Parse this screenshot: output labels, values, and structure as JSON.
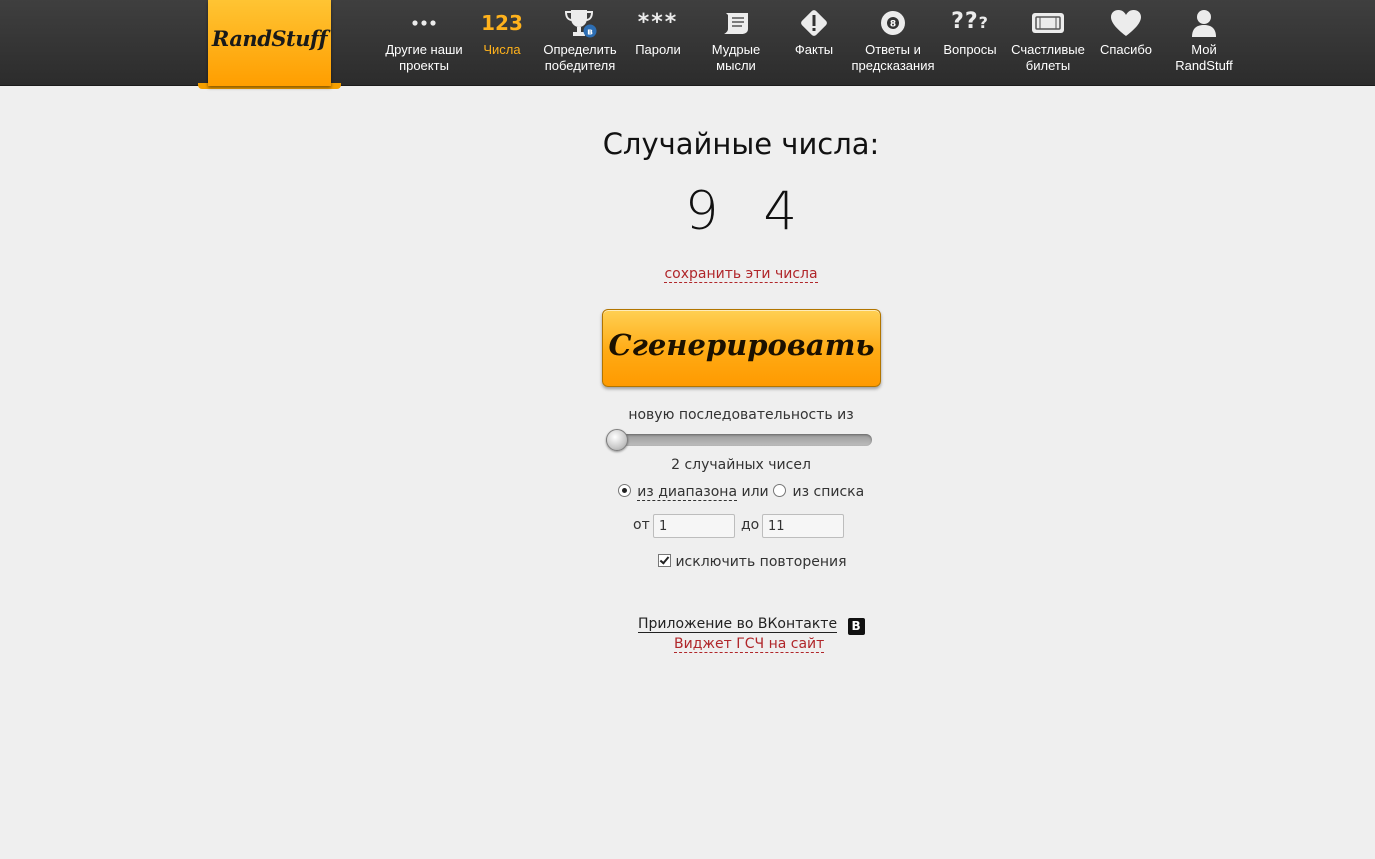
{
  "logo": {
    "text": "RandStuff"
  },
  "nav": [
    {
      "icon": "dots-icon",
      "label_line1": "Другие наши",
      "label_line2": "проекты"
    },
    {
      "icon": "numbers-icon",
      "icon_text": "123",
      "label_line1": "Числа",
      "label_line2": ""
    },
    {
      "icon": "trophy-icon",
      "label_line1": "Определить",
      "label_line2": "победителя"
    },
    {
      "icon": "asterisks-icon",
      "icon_text": "***",
      "label_line1": "Пароли",
      "label_line2": ""
    },
    {
      "icon": "scroll-icon",
      "label_line1": "Мудрые",
      "label_line2": "мысли"
    },
    {
      "icon": "warning-icon",
      "label_line1": "Факты",
      "label_line2": ""
    },
    {
      "icon": "eight-ball-icon",
      "icon_text": "8",
      "label_line1": "Ответы и",
      "label_line2": "предсказания"
    },
    {
      "icon": "question-icon",
      "icon_text": "??",
      "label_line1": "Вопросы",
      "label_line2": ""
    },
    {
      "icon": "ticket-icon",
      "label_line1": "Счастливые",
      "label_line2": "билеты"
    },
    {
      "icon": "heart-icon",
      "label_line1": "Спасибо",
      "label_line2": ""
    },
    {
      "icon": "user-icon",
      "label_line1": "Мой",
      "label_line2": "RandStuff"
    }
  ],
  "active_nav": "Числа",
  "trophy_badge": "в",
  "main": {
    "heading": "Случайные числа:",
    "numbers": "9 4",
    "save_link": "сохранить эти числа",
    "generate_button": "Сгенерировать",
    "sequence_label": "новую последовательность из",
    "count_label": "2 случайных чисел",
    "count_value": 2,
    "mode_range": "из диапазона",
    "mode_or": "или",
    "mode_list": "из списка",
    "from_label": "от",
    "from_value": "1",
    "to_label": "до",
    "to_value": "11",
    "exclude_repeats": "исключить повторения",
    "vk_app": "Приложение во ВКонтакте",
    "vk_badge": "В",
    "widget_link": "Виджет ГСЧ на сайт"
  },
  "colors": {
    "accent": "#ffaa14",
    "active_nav": "#ffb21c",
    "link": "#b0262a",
    "topbar": "#333333"
  }
}
